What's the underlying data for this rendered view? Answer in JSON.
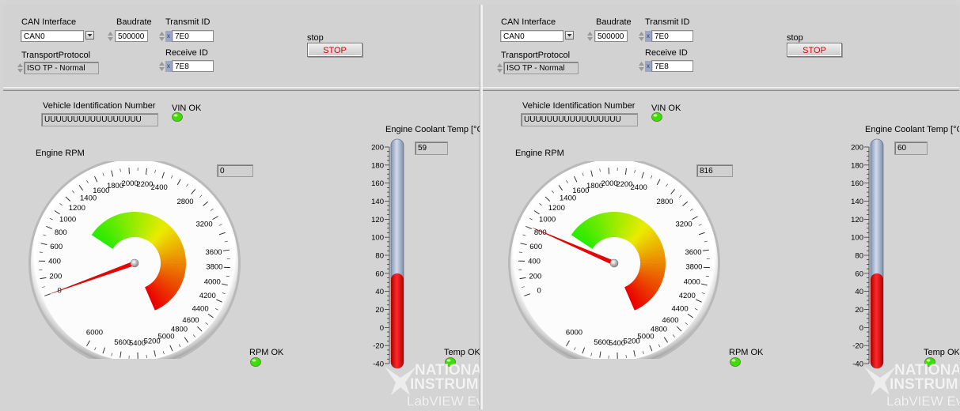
{
  "panels": [
    {
      "can_interface": {
        "label": "CAN Interface",
        "value": "CAN0"
      },
      "baudrate": {
        "label": "Baudrate",
        "value": "500000"
      },
      "transmit_id": {
        "label": "Transmit ID",
        "value": "7E0"
      },
      "receive_id": {
        "label": "Receive ID",
        "value": "7E8"
      },
      "transport_protocol": {
        "label": "TransportProtocol",
        "value": "ISO TP - Normal"
      },
      "stop": {
        "label": "stop",
        "button": "STOP"
      },
      "vin": {
        "label": "Vehicle Identification Number",
        "value": "UUUUUUUUUUUUUUUUU"
      },
      "vin_ok": "VIN OK",
      "rpm": {
        "label": "Engine RPM",
        "value": "0",
        "needle": 0
      },
      "rpm_ok": "RPM OK",
      "coolant": {
        "label": "Engine Coolant Temp [°C]",
        "value": "59",
        "level": 60
      },
      "temp_ok": "Temp OK"
    },
    {
      "can_interface": {
        "label": "CAN Interface",
        "value": "CAN0"
      },
      "baudrate": {
        "label": "Baudrate",
        "value": "500000"
      },
      "transmit_id": {
        "label": "Transmit ID",
        "value": "7E0"
      },
      "receive_id": {
        "label": "Receive ID",
        "value": "7E8"
      },
      "transport_protocol": {
        "label": "TransportProtocol",
        "value": "ISO TP - Normal"
      },
      "stop": {
        "label": "stop",
        "button": "STOP"
      },
      "vin": {
        "label": "Vehicle Identification Number",
        "value": "UUUUUUUUUUUUUUUUU"
      },
      "vin_ok": "VIN OK",
      "rpm": {
        "label": "Engine RPM",
        "value": "816",
        "needle": 816
      },
      "rpm_ok": "RPM OK",
      "coolant": {
        "label": "Engine Coolant Temp [°C]",
        "value": "60",
        "level": 60
      },
      "temp_ok": "Temp OK"
    }
  ],
  "gauge_scale": {
    "min": 0,
    "max": 6000,
    "labels": [
      "0",
      "200",
      "400",
      "600",
      "800",
      "1000",
      "1200",
      "1400",
      "1600",
      "1800",
      "2000",
      "2200",
      "2400",
      "2800",
      "3200",
      "3600",
      "3800",
      "4000",
      "4200",
      "4400",
      "4600",
      "4800",
      "5000",
      "5200",
      "5400",
      "5600",
      "6000"
    ]
  },
  "thermo_scale": {
    "min": -40,
    "max": 200,
    "labels": [
      "200",
      "180",
      "160",
      "140",
      "120",
      "100",
      "80",
      "60",
      "40",
      "20",
      "0",
      "-20",
      "-40"
    ]
  },
  "watermark": {
    "line1": "NATIONAL",
    "line2": "INSTRUMENTS",
    "line3": "LabVIEW Evaluation"
  },
  "colors": {
    "led_on": "#3ce000",
    "stop_text": "#e00000",
    "mercury": "#e00000",
    "tube": "#a9b7d3"
  }
}
